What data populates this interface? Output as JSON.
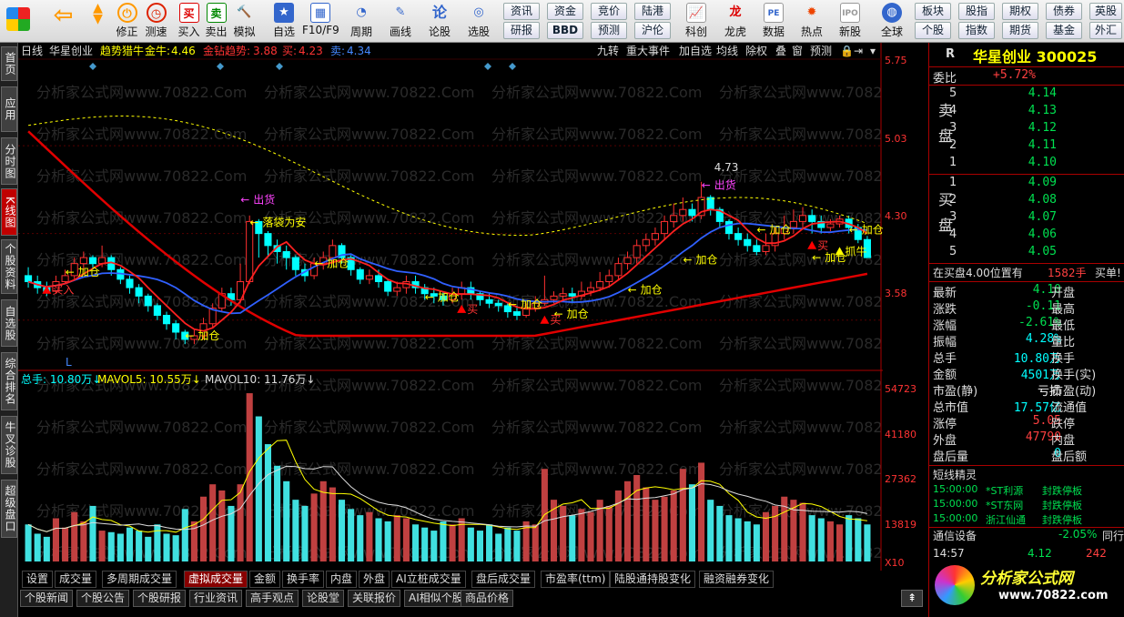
{
  "toolbar": {
    "buttons": [
      "买入",
      "卖出",
      "模拟",
      "自选",
      "F10/F9",
      "周期",
      "画线",
      "论股",
      "选股",
      "科创",
      "龙虎",
      "数据",
      "热点",
      "新股",
      "全球"
    ],
    "left_buttons": [
      "修正",
      "测速"
    ],
    "small": [
      "资讯",
      "资金",
      "竞价",
      "陆港",
      "研报",
      "BBD",
      "预测",
      "沪伦",
      "板块",
      "股指",
      "期权",
      "债券",
      "英股",
      "个股",
      "指数",
      "期货",
      "基金",
      "外汇"
    ]
  },
  "leftnav": [
    "首页",
    "应用",
    "分时图",
    "K线图",
    "个股资料",
    "自选股",
    "综合排名",
    "牛叉诊股",
    "超级盘口"
  ],
  "chart": {
    "header": {
      "period": "日线",
      "name": "华星创业",
      "indicator": "趋势猎牛",
      "gold_label": "金牛:",
      "gold_val": "4.46",
      "trend_label": "金钻趋势:",
      "trend_val": "3.88",
      "buy_label": "买:",
      "buy_val": "4.23",
      "sell_label": "卖:",
      "sell_val": "4.34"
    },
    "tools": [
      "九转",
      "重大事件",
      "加自选",
      "均线",
      "除权",
      "叠",
      "窗",
      "预测"
    ],
    "price_ticks": [
      "5.75",
      "5.03",
      "4.30",
      "3.58"
    ],
    "vol_ticks": [
      "54723",
      "41180",
      "27362",
      "13819"
    ],
    "vol_unit": "X10",
    "watermark": "分析家公式网www.70822.Com",
    "l_mark": "L",
    "vol_header": {
      "total": "总手: 10.80万↓",
      "ma5": "MAVOL5: 10.55万↓",
      "ma10": "MAVOL10: 11.76万↓"
    },
    "signals": {
      "out": "出货",
      "fall": "落袋为安",
      "add": "加仓",
      "buy": "买入",
      "buy2": "买",
      "grab": "抓牛",
      "peak": "4.73"
    }
  },
  "chart_data": {
    "type": "candlestick",
    "title": "华星创业 日线",
    "ylim": [
      3.2,
      5.75
    ],
    "candles": [
      [
        3.95,
        3.9,
        4.02,
        3.85
      ],
      [
        3.9,
        3.85,
        3.95,
        3.8
      ],
      [
        3.85,
        3.82,
        3.9,
        3.78
      ],
      [
        3.82,
        3.9,
        3.95,
        3.8
      ],
      [
        3.9,
        3.95,
        4.0,
        3.88
      ],
      [
        3.95,
        4.05,
        4.1,
        3.92
      ],
      [
        4.05,
        4.1,
        4.15,
        4.0
      ],
      [
        4.1,
        4.05,
        4.12,
        4.0
      ],
      [
        4.05,
        4.1,
        4.2,
        4.02
      ],
      [
        4.1,
        4.0,
        4.12,
        3.95
      ],
      [
        4.0,
        3.92,
        4.02,
        3.88
      ],
      [
        3.92,
        3.85,
        3.95,
        3.8
      ],
      [
        3.85,
        3.78,
        3.88,
        3.72
      ],
      [
        3.78,
        3.7,
        3.8,
        3.65
      ],
      [
        3.7,
        3.62,
        3.72,
        3.58
      ],
      [
        3.62,
        3.55,
        3.65,
        3.5
      ],
      [
        3.55,
        3.48,
        3.58,
        3.42
      ],
      [
        3.48,
        3.42,
        3.5,
        3.38
      ],
      [
        3.42,
        3.45,
        3.5,
        3.38
      ],
      [
        3.45,
        3.55,
        3.6,
        3.42
      ],
      [
        3.55,
        3.68,
        3.72,
        3.52
      ],
      [
        3.68,
        3.8,
        3.85,
        3.65
      ],
      [
        3.8,
        3.75,
        3.85,
        3.7
      ],
      [
        3.75,
        3.9,
        4.05,
        3.72
      ],
      [
        3.9,
        4.4,
        4.45,
        3.88
      ],
      [
        4.4,
        4.3,
        4.42,
        4.1
      ],
      [
        4.3,
        4.2,
        4.32,
        4.1
      ],
      [
        4.2,
        4.15,
        4.25,
        4.05
      ],
      [
        4.15,
        4.1,
        4.2,
        4.0
      ],
      [
        4.1,
        4.0,
        4.12,
        3.95
      ],
      [
        4.0,
        3.95,
        4.05,
        3.9
      ],
      [
        3.95,
        4.05,
        4.1,
        3.92
      ],
      [
        4.05,
        4.1,
        4.15,
        4.0
      ],
      [
        4.1,
        4.2,
        4.25,
        4.05
      ],
      [
        4.2,
        4.1,
        4.22,
        4.05
      ],
      [
        4.1,
        4.0,
        4.12,
        3.95
      ],
      [
        4.0,
        3.92,
        4.02,
        3.88
      ],
      [
        3.92,
        3.95,
        4.0,
        3.88
      ],
      [
        3.95,
        3.9,
        4.0,
        3.85
      ],
      [
        3.9,
        3.82,
        3.92,
        3.78
      ],
      [
        3.82,
        3.85,
        3.9,
        3.78
      ],
      [
        3.85,
        3.9,
        3.95,
        3.8
      ],
      [
        3.9,
        3.85,
        3.95,
        3.8
      ],
      [
        3.85,
        3.8,
        3.88,
        3.75
      ],
      [
        3.8,
        3.78,
        3.85,
        3.72
      ],
      [
        3.78,
        3.75,
        3.82,
        3.7
      ],
      [
        3.75,
        3.8,
        3.85,
        3.72
      ],
      [
        3.8,
        3.85,
        3.9,
        3.75
      ],
      [
        3.85,
        3.8,
        3.9,
        3.75
      ],
      [
        3.8,
        3.75,
        3.82,
        3.7
      ],
      [
        3.75,
        3.72,
        3.8,
        3.68
      ],
      [
        3.72,
        3.7,
        3.75,
        3.65
      ],
      [
        3.7,
        3.65,
        3.72,
        3.6
      ],
      [
        3.65,
        3.62,
        3.7,
        3.58
      ],
      [
        3.62,
        3.68,
        3.72,
        3.6
      ],
      [
        3.68,
        3.72,
        3.78,
        3.65
      ],
      [
        3.72,
        3.75,
        3.95,
        3.7
      ],
      [
        3.75,
        3.78,
        3.82,
        3.72
      ],
      [
        3.78,
        3.8,
        3.85,
        3.75
      ],
      [
        3.8,
        3.78,
        3.85,
        3.72
      ],
      [
        3.78,
        3.82,
        3.9,
        3.75
      ],
      [
        3.82,
        3.85,
        3.9,
        3.78
      ],
      [
        3.85,
        3.9,
        3.98,
        3.82
      ],
      [
        3.9,
        3.95,
        4.0,
        3.85
      ],
      [
        3.95,
        4.05,
        4.1,
        3.92
      ],
      [
        4.05,
        4.1,
        4.15,
        4.0
      ],
      [
        4.1,
        4.2,
        4.25,
        4.05
      ],
      [
        4.2,
        4.25,
        4.3,
        4.15
      ],
      [
        4.25,
        4.3,
        4.35,
        4.2
      ],
      [
        4.3,
        4.4,
        4.45,
        4.25
      ],
      [
        4.4,
        4.45,
        4.55,
        4.35
      ],
      [
        4.45,
        4.5,
        4.6,
        4.4
      ],
      [
        4.5,
        4.45,
        4.55,
        4.4
      ],
      [
        4.45,
        4.6,
        4.73,
        4.42
      ],
      [
        4.6,
        4.5,
        4.62,
        4.45
      ],
      [
        4.5,
        4.4,
        4.52,
        4.35
      ],
      [
        4.4,
        4.3,
        4.42,
        4.25
      ],
      [
        4.3,
        4.25,
        4.35,
        4.2
      ],
      [
        4.25,
        4.2,
        4.3,
        4.15
      ],
      [
        4.2,
        4.15,
        4.25,
        4.12
      ],
      [
        4.15,
        4.2,
        4.3,
        4.12
      ],
      [
        4.2,
        4.3,
        4.35,
        4.15
      ],
      [
        4.3,
        4.35,
        4.45,
        4.25
      ],
      [
        4.35,
        4.4,
        4.5,
        4.3
      ],
      [
        4.4,
        4.45,
        4.52,
        4.35
      ],
      [
        4.45,
        4.4,
        4.5,
        4.3
      ],
      [
        4.4,
        4.35,
        4.45,
        4.3
      ],
      [
        4.35,
        4.38,
        4.42,
        4.32
      ],
      [
        4.38,
        4.42,
        4.45,
        4.35
      ],
      [
        4.42,
        4.35,
        4.45,
        4.3
      ],
      [
        4.35,
        4.25,
        4.38,
        4.22
      ],
      [
        4.25,
        4.1,
        4.28,
        4.1
      ]
    ],
    "volume": [
      120,
      90,
      80,
      140,
      110,
      160,
      130,
      180,
      100,
      95,
      90,
      110,
      100,
      80,
      120,
      90,
      85,
      170,
      130,
      210,
      250,
      230,
      180,
      250,
      545,
      470,
      380,
      310,
      260,
      200,
      180,
      220,
      260,
      240,
      200,
      170,
      150,
      160,
      140,
      130,
      150,
      140,
      120,
      110,
      100,
      130,
      120,
      140,
      110,
      100,
      120,
      90,
      110,
      100,
      130,
      120,
      300,
      200,
      180,
      150,
      170,
      160,
      200,
      180,
      230,
      260,
      280,
      240,
      200,
      210,
      230,
      300,
      250,
      320,
      200,
      180,
      150,
      140,
      130,
      120,
      160,
      180,
      210,
      200,
      190,
      150,
      140,
      130,
      120,
      150,
      140,
      120
    ],
    "series": [
      {
        "name": "金钻趋势",
        "color": "#e00000"
      },
      {
        "name": "卖",
        "color": "#3060ff"
      },
      {
        "name": "买",
        "color": "#ff0000"
      }
    ]
  },
  "right": {
    "code_label": "R",
    "title": "华星创业 300025",
    "weibi_label": "委比",
    "weibi_val": "+5.72%",
    "sell_label": "卖盘",
    "buy_label": "买盘",
    "asks": [
      {
        "n": "5",
        "p": "4.14"
      },
      {
        "n": "4",
        "p": "4.13"
      },
      {
        "n": "3",
        "p": "4.12"
      },
      {
        "n": "2",
        "p": "4.11"
      },
      {
        "n": "1",
        "p": "4.10"
      }
    ],
    "bids": [
      {
        "n": "1",
        "p": "4.09"
      },
      {
        "n": "2",
        "p": "4.08"
      },
      {
        "n": "3",
        "p": "4.07"
      },
      {
        "n": "4",
        "p": "4.06"
      },
      {
        "n": "5",
        "p": "4.05"
      }
    ],
    "notice_a": "在买盘4.00位置有",
    "notice_b": "1582手",
    "notice_c": "买单!",
    "stats": [
      {
        "l": "最新",
        "v": "4.10",
        "c": "grn",
        "r": "开盘"
      },
      {
        "l": "涨跌",
        "v": "-0.11",
        "c": "grn",
        "r": "最高"
      },
      {
        "l": "涨幅",
        "v": "-2.61%",
        "c": "grn",
        "r": "最低"
      },
      {
        "l": "振幅",
        "v": "4.28%",
        "c": "cy",
        "r": "量比"
      },
      {
        "l": "总手",
        "v": "10.80万",
        "c": "cy",
        "r": "换手"
      },
      {
        "l": "金额",
        "v": "4501万",
        "c": "cy",
        "r": "换手(实)"
      },
      {
        "l": "市盈(静)",
        "v": "亏损",
        "c": "wh",
        "r": "市盈(动)"
      },
      {
        "l": "总市值",
        "v": "17.57亿",
        "c": "cy",
        "r": "流通值"
      },
      {
        "l": "涨停",
        "v": "5.05",
        "c": "red",
        "r": "跌停"
      },
      {
        "l": "外盘",
        "v": "47790",
        "c": "red",
        "r": "内盘"
      },
      {
        "l": "盘后量",
        "v": "0",
        "c": "cy",
        "r": "盘后额"
      }
    ],
    "short_title": "短线精灵",
    "short": [
      {
        "t": "15:00:00",
        "n": "*ST利源",
        "e": "封跌停板"
      },
      {
        "t": "15:00:00",
        "n": "*ST东网",
        "e": "封跌停板"
      },
      {
        "t": "15:00:00",
        "n": "浙江仙通",
        "e": "封跌停板"
      }
    ],
    "comm": "通信设备",
    "comm_val": "-2.05%",
    "comm_r": "同行",
    "last_time": "14:57",
    "last_price": "4.12",
    "last_vol": "242",
    "logo_text": "分析家公式网",
    "logo_url": "www.70822.com"
  },
  "bottom_tabs": [
    "设置",
    "成交量",
    "多周期成交量",
    "虚拟成交量",
    "金额",
    "换手率",
    "内盘",
    "外盘",
    "AI立桩成交量",
    "盘后成交量",
    "市盈率(ttm)",
    "陆股通持股变化",
    "融资融券变化"
  ],
  "news_tabs": [
    "个股新闻",
    "个股公告",
    "个股研报",
    "行业资讯",
    "高手观点",
    "论股堂",
    "关联报价",
    "AI相似个股",
    "商品价格"
  ]
}
